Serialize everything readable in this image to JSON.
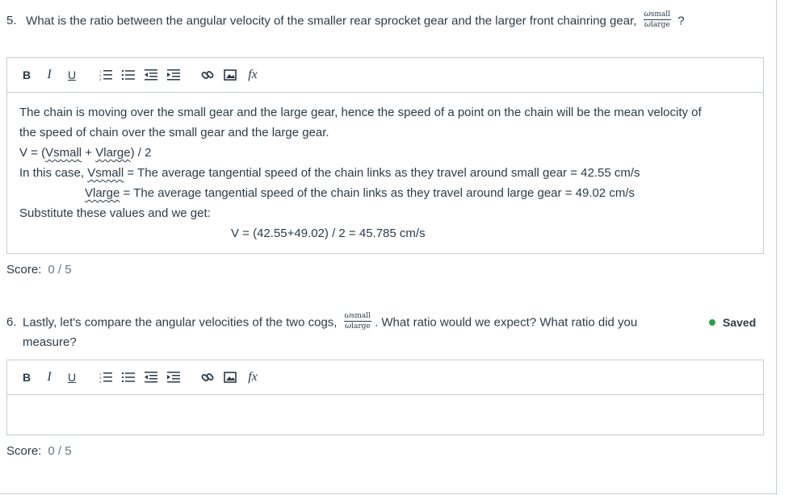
{
  "question5": {
    "number": "5.",
    "text": "What is the ratio between the angular velocity of the smaller rear sprocket gear and the larger front chainring gear,",
    "frac_num_sym": "ω",
    "frac_num_sub": "small",
    "frac_den_sym": "ω",
    "frac_den_sub": "large",
    "tail": "?"
  },
  "toolbar": {
    "bold_label": "B",
    "italic_label": "I",
    "underline_label": "U",
    "fx_label": "fx"
  },
  "answer5": {
    "line1": "The chain is moving over the small gear and the large gear, hence the speed of a point on the chain will be the mean velocity of",
    "line2": "the speed of chain over the small gear and the large gear.",
    "line3_pre": "V = (",
    "line3_w1": "Vsmall",
    "line3_mid": " + ",
    "line3_w2": "Vlarge",
    "line3_post": ") / 2",
    "line4_pre": "In this case, ",
    "line4_w": "Vsmall",
    "line4_post": " = The average tangential speed of the chain links as they travel around small gear = 42.55 cm/s",
    "line5_w": "Vlarge",
    "line5_post": " = The average tangential speed of the chain links as they travel around large gear = 49.02 cm/s",
    "line6": "Substitute these values and we get:",
    "line7": "V = (42.55+49.02) / 2 = 45.785 cm/s"
  },
  "score5": {
    "label": "Score:",
    "value": "0 / 5"
  },
  "question6": {
    "number": "6.",
    "text_pre": "Lastly, let's compare the angular velocities of the two cogs,",
    "frac_num_sym": "ω",
    "frac_num_sub": "small",
    "frac_den_sym": "ω",
    "frac_den_sub": "large",
    "text_post": ". What ratio would we expect? What ratio did you",
    "text_cont": "measure?"
  },
  "saved_status": {
    "label": "Saved",
    "color": "#2e9e4f"
  },
  "score6": {
    "label": "Score:",
    "value": "0 / 5"
  }
}
